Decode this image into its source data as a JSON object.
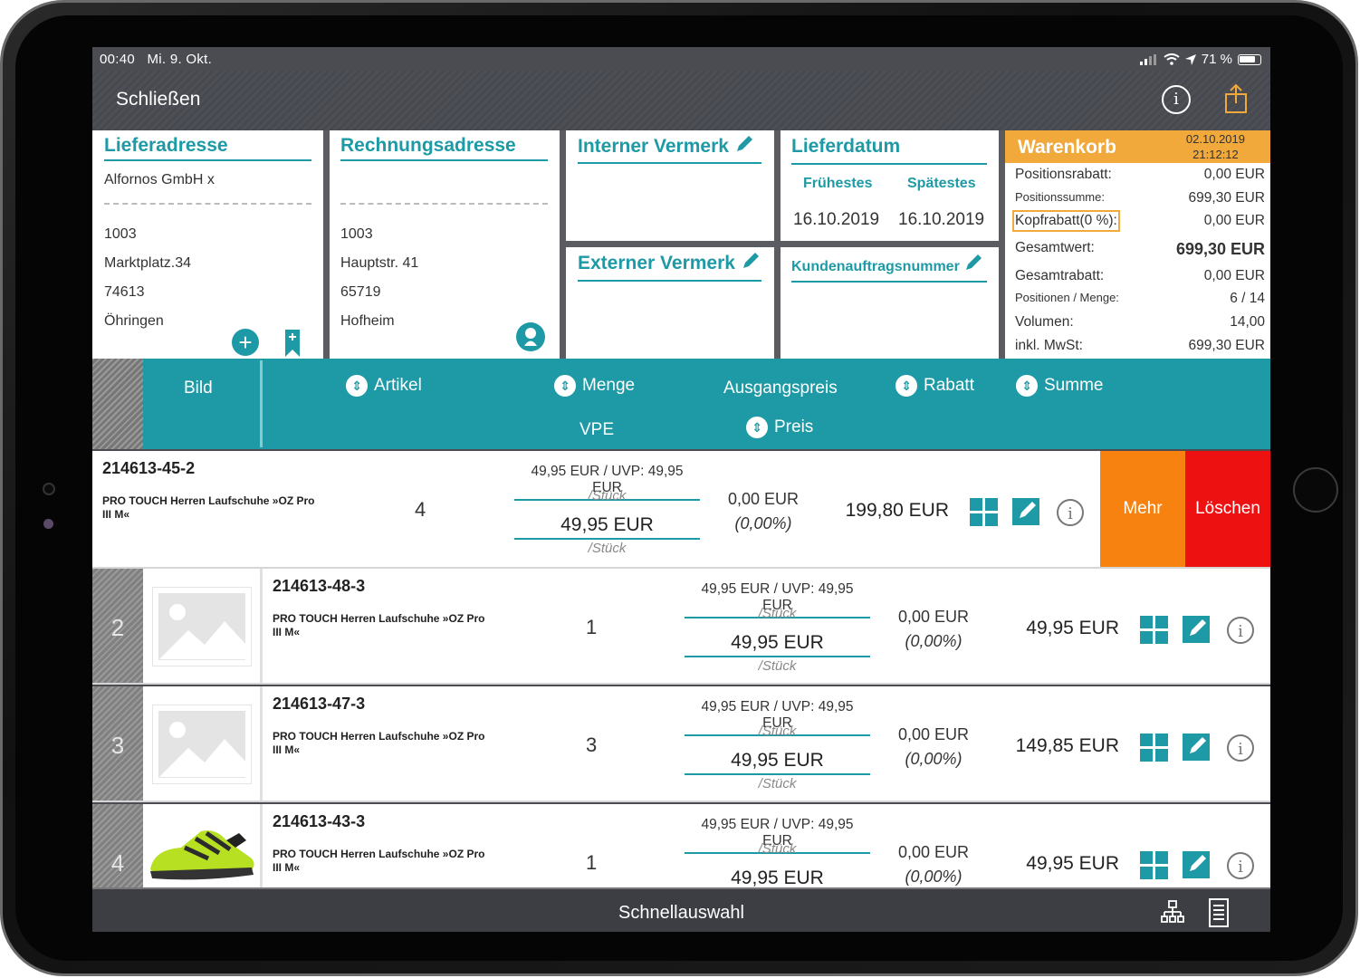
{
  "status": {
    "time": "00:40",
    "date": "Mi. 9. Okt.",
    "battery": "71 %"
  },
  "nav": {
    "close_label": "Schließen"
  },
  "delivery": {
    "title": "Lieferadresse",
    "name": "Alfornos GmbH x",
    "number": "1003",
    "street": "Marktplatz.34",
    "zip": "74613",
    "city": "Öhringen"
  },
  "billing": {
    "title": "Rechnungsadresse",
    "number": "1003",
    "street": "Hauptstr. 41",
    "zip": "65719",
    "city": "Hofheim"
  },
  "notes": {
    "internal_title": "Interner Vermerk",
    "external_title": "Externer Vermerk"
  },
  "delivery_date": {
    "title": "Lieferdatum",
    "earliest_label": "Frühestes",
    "latest_label": "Spätestes",
    "earliest": "16.10.2019",
    "latest": "16.10.2019",
    "customer_order_label": "Kundenauftragsnummer"
  },
  "cart": {
    "title": "Warenkorb",
    "date": "02.10.2019",
    "time": "21:12:12",
    "rows": [
      {
        "label": "Positionsrabatt:",
        "value": "0,00 EUR"
      },
      {
        "label": "Positionssumme:",
        "value": "699,30 EUR"
      },
      {
        "label": "Kopfrabatt(0 %):",
        "value": "0,00 EUR"
      },
      {
        "label": "Gesamtwert:",
        "value": "699,30 EUR"
      },
      {
        "label": "Gesamtrabatt:",
        "value": "0,00 EUR"
      },
      {
        "label": "Positionen / Menge:",
        "value": "6 / 14"
      },
      {
        "label": "Volumen:",
        "value": "14,00"
      },
      {
        "label": "inkl. MwSt:",
        "value": "699,30 EUR"
      }
    ]
  },
  "table_header": {
    "image": "Bild",
    "article": "Artikel",
    "quantity": "Menge",
    "base_price": "Ausgangspreis",
    "discount": "Rabatt",
    "sum": "Summe",
    "vpe": "VPE",
    "price": "Preis"
  },
  "rows": [
    {
      "num": "",
      "sku": "214613-45-2",
      "name": "PRO TOUCH Herren Laufschuhe »OZ Pro III M«",
      "qty": "4",
      "uvp": "49,95 EUR / UVP: 49,95 EUR",
      "unit": "/Stück",
      "price": "49,95 EUR",
      "discount": "0,00 EUR",
      "discount_pct": "(0,00%)",
      "sum": "199,80 EUR"
    },
    {
      "num": "2",
      "sku": "214613-48-3",
      "name": "PRO TOUCH Herren Laufschuhe »OZ Pro III M«",
      "qty": "1",
      "uvp": "49,95 EUR / UVP: 49,95 EUR",
      "unit": "/Stück",
      "price": "49,95 EUR",
      "discount": "0,00 EUR",
      "discount_pct": "(0,00%)",
      "sum": "49,95 EUR"
    },
    {
      "num": "3",
      "sku": "214613-47-3",
      "name": "PRO TOUCH Herren Laufschuhe »OZ Pro III M«",
      "qty": "3",
      "uvp": "49,95 EUR / UVP: 49,95 EUR",
      "unit": "/Stück",
      "price": "49,95 EUR",
      "discount": "0,00 EUR",
      "discount_pct": "(0,00%)",
      "sum": "149,85 EUR"
    },
    {
      "num": "4",
      "sku": "214613-43-3",
      "name": "PRO TOUCH Herren Laufschuhe »OZ Pro III M«",
      "qty": "1",
      "uvp": "49,95 EUR / UVP: 49,95 EUR",
      "unit": "/Stück",
      "price": "49,95 EUR",
      "discount": "0,00 EUR",
      "discount_pct": "(0,00%)",
      "sum": "49,95 EUR"
    }
  ],
  "row_actions": {
    "more": "Mehr",
    "delete": "Löschen"
  },
  "bottom": {
    "title": "Schnellauswahl"
  },
  "colors": {
    "teal": "#1d9aa6",
    "orange": "#f7820f",
    "red": "#ee1111",
    "cart_header": "#f2a93b"
  }
}
